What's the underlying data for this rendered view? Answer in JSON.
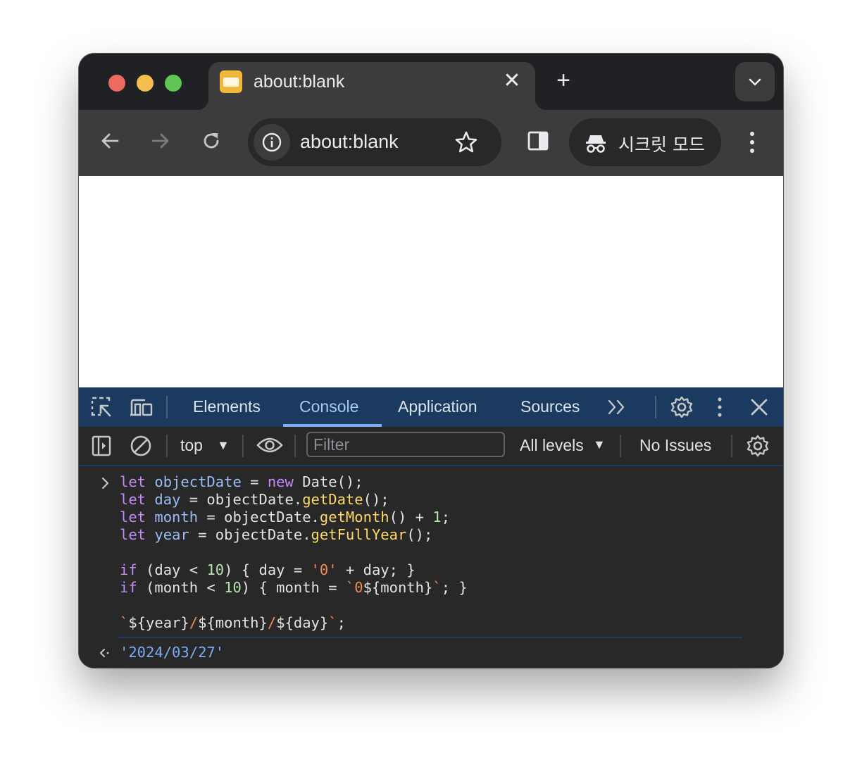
{
  "tab": {
    "title": "about:blank",
    "close": "✕",
    "new_tab": "+"
  },
  "omnibox": {
    "url": "about:blank"
  },
  "incognito": {
    "label": "시크릿 모드"
  },
  "devtools": {
    "tabs": [
      "Elements",
      "Console",
      "Application",
      "Sources"
    ],
    "active_tab": "Console",
    "context": "top",
    "filter_placeholder": "Filter",
    "levels": "All levels",
    "issues": "No Issues"
  },
  "console": {
    "input_lines": [
      "let objectDate = new Date();",
      "let day = objectDate.getDate();",
      "let month = objectDate.getMonth() + 1;",
      "let year = objectDate.getFullYear();",
      "",
      "if (day < 10) { day = '0' + day; }",
      "if (month < 10) { month = `0${month}`; }",
      "",
      "`${year}/${month}/${day}`;"
    ],
    "result": "'2024/03/27'"
  },
  "colors": {
    "keyword": "#c58af9",
    "variable": "#9bbbf7",
    "function": "#ffd966",
    "number": "#b6e3b0",
    "string": "#f28b54",
    "devtools_tabbar": "#1b3a5f"
  }
}
